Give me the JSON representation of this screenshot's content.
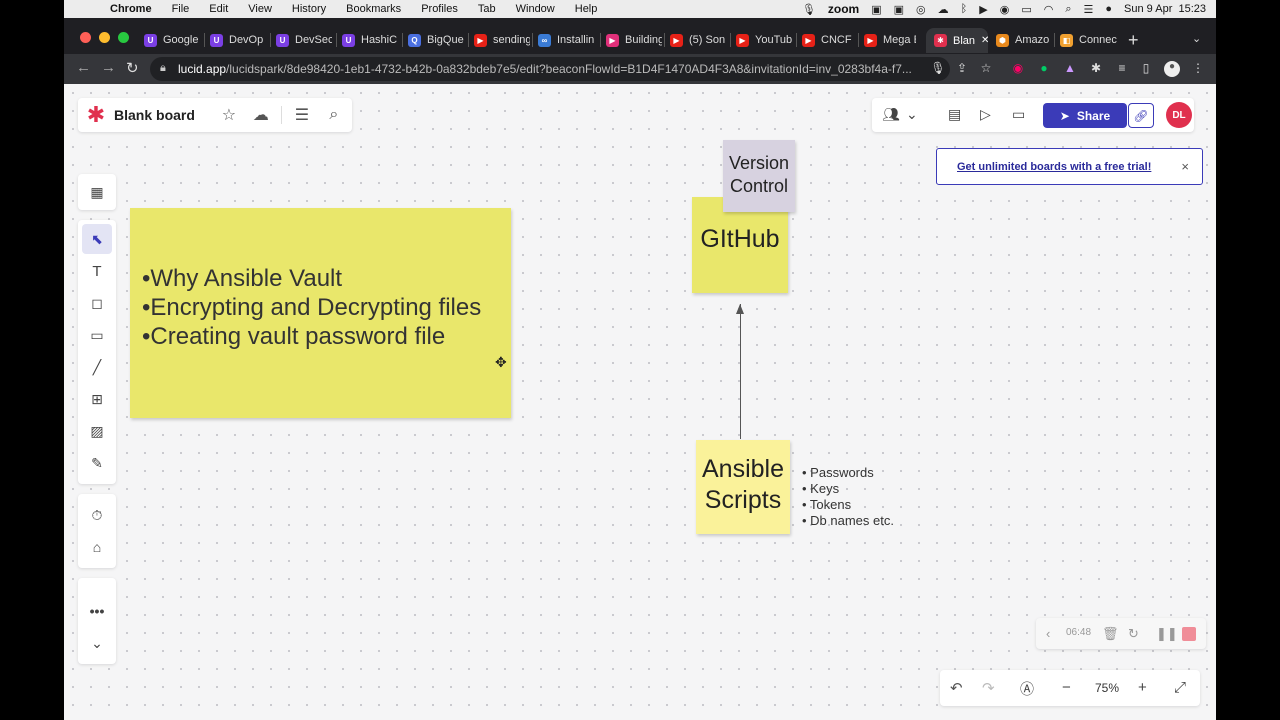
{
  "menubar": {
    "app": "Chrome",
    "items": [
      "File",
      "Edit",
      "View",
      "History",
      "Bookmarks",
      "Profiles",
      "Tab",
      "Window",
      "Help"
    ],
    "zoom_label": "zoom",
    "datetime": "Sun 9 Apr  15:23"
  },
  "tabs": [
    {
      "label": "Google",
      "fav": "purple"
    },
    {
      "label": "DevOp",
      "fav": "purple"
    },
    {
      "label": "DevSec",
      "fav": "purple"
    },
    {
      "label": "HashiC",
      "fav": "purple"
    },
    {
      "label": "BigQue",
      "fav": "search"
    },
    {
      "label": "sending",
      "fav": "youtube"
    },
    {
      "label": "Installin",
      "fav": "blue"
    },
    {
      "label": "Building",
      "fav": "pink"
    },
    {
      "label": "(5) Son",
      "fav": "youtube"
    },
    {
      "label": "YouTub",
      "fav": "youtube"
    },
    {
      "label": "CNCF S",
      "fav": "youtube"
    },
    {
      "label": "Mega E",
      "fav": "youtube"
    },
    {
      "label": "Blan",
      "fav": "lucid",
      "active": true
    },
    {
      "label": "Amazo",
      "fav": "orange"
    },
    {
      "label": "Connec",
      "fav": "orange2"
    }
  ],
  "address": {
    "host": "lucid.app",
    "path": "/lucidspark/8de98420-1eb1-4732-b42b-0a832bdeb7e5/edit?beaconFlowId=B1D4F1470AD4F3A8&invitationId=inv_0283bf4a-f7..."
  },
  "board": {
    "title": "Blank board"
  },
  "header": {
    "share_label": "Share",
    "avatar_initials": "DL"
  },
  "promo": {
    "link": "Get unlimited boards with a free trial!",
    "close": "×"
  },
  "stickies": {
    "main_bullets": [
      "•Why Ansible Vault",
      "•Encrypting and Decrypting files",
      "•Creating vault password file"
    ],
    "version_control": [
      "Version",
      "Control"
    ],
    "github": "GItHub",
    "ansible": [
      "Ansible",
      "Scripts"
    ]
  },
  "notes": [
    "• Passwords",
    "• Keys",
    "• Tokens",
    "• Db names etc."
  ],
  "recorder": {
    "time": "06:48"
  },
  "zoom": {
    "level": "75%"
  },
  "colors": {
    "brand": "#e0304e",
    "accent": "#3b3bb8",
    "sticky_yellow": "#e9e76b",
    "sticky_light_yellow": "#faf29a",
    "sticky_lavender": "#d7d2e0"
  }
}
